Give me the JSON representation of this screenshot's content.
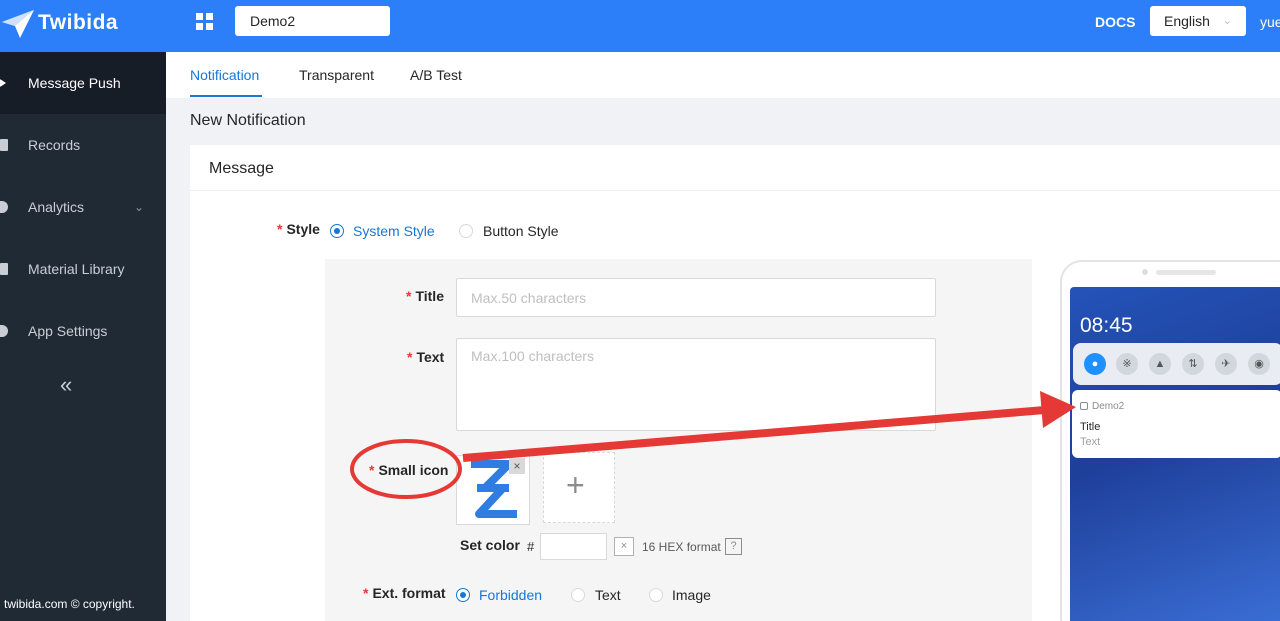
{
  "topbar": {
    "logo_text": "Twibida",
    "app_selected": "Demo2",
    "docs": "DOCS",
    "language": "English",
    "user": "yue"
  },
  "sidebar": {
    "items": [
      {
        "label": "Message Push",
        "icon": "send-icon"
      },
      {
        "label": "Records",
        "icon": "list-icon"
      },
      {
        "label": "Analytics",
        "icon": "chart-icon"
      },
      {
        "label": "Material Library",
        "icon": "folder-icon"
      },
      {
        "label": "App Settings",
        "icon": "gear-icon"
      }
    ],
    "collapse": "«",
    "copyright": "twibida.com © copyright."
  },
  "tabs": [
    "Notification",
    "Transparent",
    "A/B Test"
  ],
  "page_title": "New Notification",
  "card_title": "Message",
  "form": {
    "style_label": "Style",
    "style_options": [
      "System Style",
      "Button Style"
    ],
    "title_label": "Title",
    "title_placeholder": "Max.50 characters",
    "text_label": "Text",
    "text_placeholder": "Max.100 characters",
    "small_icon_label": "Small icon",
    "set_color_label": "Set color",
    "hash": "#",
    "color_hint": "16 HEX format",
    "ext_label": "Ext. format",
    "ext_options": [
      "Forbidden",
      "Text",
      "Image"
    ],
    "required_mark": "*",
    "close_glyph": "×",
    "plus_glyph": "+",
    "question_glyph": "?"
  },
  "preview": {
    "time": "08:45",
    "app_name": "Demo2",
    "title": "Title",
    "text": "Text"
  },
  "colors": {
    "topbar": "#2d7ff9",
    "sidebar": "#202a35",
    "accent": "#1677d4",
    "annotation": "#e53935"
  }
}
